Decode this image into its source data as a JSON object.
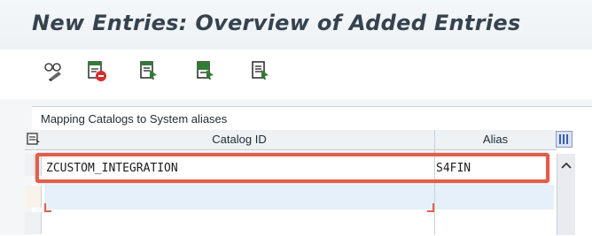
{
  "window": {
    "title": "New Entries: Overview of Added Entries"
  },
  "toolbar": {
    "buttons": [
      {
        "name": "display-change-button",
        "icon": "glasses-pencil-icon"
      },
      {
        "name": "delete-button",
        "icon": "delete-document-icon"
      },
      {
        "name": "select-all-button",
        "icon": "select-all-icon"
      },
      {
        "name": "select-block-button",
        "icon": "select-block-icon"
      },
      {
        "name": "deselect-all-button",
        "icon": "deselect-all-icon"
      }
    ]
  },
  "table": {
    "caption": "Mapping Catalogs to System aliases",
    "columns": [
      "Catalog ID",
      "Alias"
    ],
    "rows": [
      {
        "catalog_id": "ZCUSTOM_INTEGRATION",
        "alias": "S4FIN"
      },
      {
        "catalog_id": "",
        "alias": ""
      }
    ]
  },
  "colors": {
    "highlight": "#e35d4b",
    "title": "#36434f",
    "selected_row": "#e6f0fa"
  }
}
